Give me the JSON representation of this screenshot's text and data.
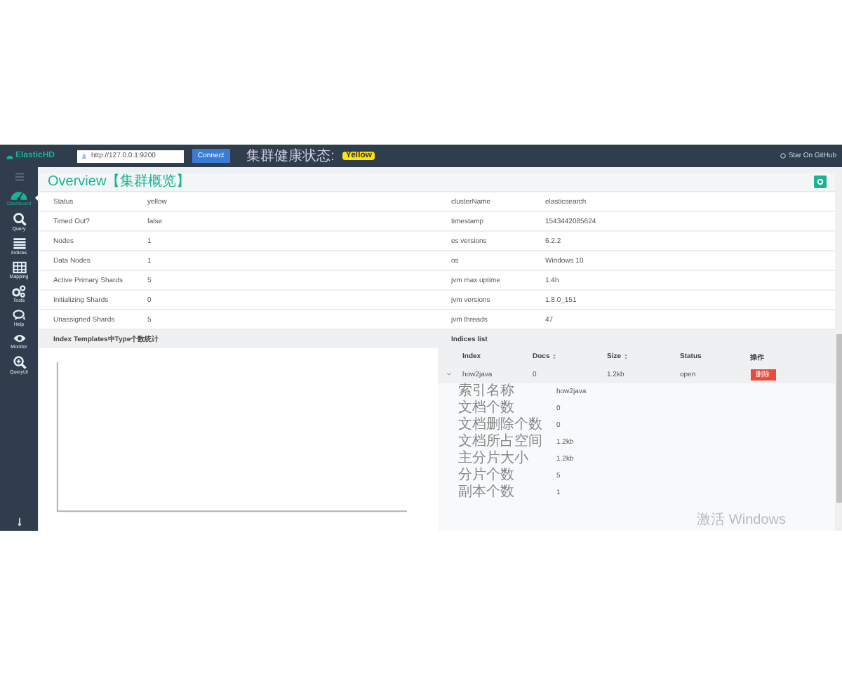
{
  "topbar": {
    "logo": "ElasticHD",
    "url": "http://127.0.0.1:9200",
    "connect": "Connect",
    "health_label": "集群健康状态:",
    "health_value": "Yellow",
    "github": "Star On GitHub"
  },
  "sidebar": {
    "items": [
      {
        "label": "Dashboard",
        "kind": "dashboard",
        "selected": true
      },
      {
        "label": "Query",
        "kind": "search",
        "selected": false
      },
      {
        "label": "Indices",
        "kind": "list",
        "selected": false
      },
      {
        "label": "Mapping",
        "kind": "grid",
        "selected": false
      },
      {
        "label": "Tools",
        "kind": "gears",
        "selected": false
      },
      {
        "label": "Help",
        "kind": "chat",
        "selected": false
      },
      {
        "label": "Monitor",
        "kind": "eye",
        "selected": false
      },
      {
        "label": "QueryUI",
        "kind": "zoom",
        "selected": false
      }
    ]
  },
  "overview": {
    "title": "Overview【集群概览】",
    "cluster_health": [
      {
        "name": "Status",
        "value": "yellow"
      },
      {
        "name": "Timed Out?",
        "value": "false"
      },
      {
        "name": "Nodes",
        "value": "1"
      },
      {
        "name": "Data Nodes",
        "value": "1"
      },
      {
        "name": "Active Primary Shards",
        "value": "5"
      },
      {
        "name": "Initializing Shards",
        "value": "0"
      },
      {
        "name": "Unassigned Shards",
        "value": "5"
      }
    ],
    "base_info": [
      {
        "name": "clusterName",
        "value": "elasticsearch"
      },
      {
        "name": "timestamp",
        "value": "1543442085624"
      },
      {
        "name": "es versions",
        "value": "6.2.2"
      },
      {
        "name": "os",
        "value": "Windows 10"
      },
      {
        "name": "jvm max uptime",
        "value": "1.4h"
      },
      {
        "name": "jvm versions",
        "value": "1.8.0_151"
      },
      {
        "name": "jvm threads",
        "value": "47"
      }
    ]
  },
  "templates": {
    "title": "Index Templates中Type个数统计"
  },
  "indices": {
    "title": "Indices list",
    "columns": [
      {
        "label": "Index",
        "sortable": false
      },
      {
        "label": "Docs",
        "sortable": true
      },
      {
        "label": "Size",
        "sortable": true
      },
      {
        "label": "Status",
        "sortable": false
      },
      {
        "label": "操作",
        "sortable": false
      }
    ],
    "rows": [
      {
        "expanded": true,
        "cells": [
          "how2java",
          "0",
          "1.2kb",
          "open"
        ],
        "action": "删除",
        "details": [
          {
            "name": "索引名称",
            "value": "how2java"
          },
          {
            "name": "文档个数",
            "value": "0"
          },
          {
            "name": "文档删除个数",
            "value": "0"
          },
          {
            "name": "文档所占空间",
            "value": "1.2kb"
          },
          {
            "name": "主分片大小",
            "value": "1.2kb"
          },
          {
            "name": "分片个数",
            "value": "5"
          },
          {
            "name": "副本个数",
            "value": "1"
          }
        ]
      }
    ]
  },
  "os_notice": "激活 Windows"
}
